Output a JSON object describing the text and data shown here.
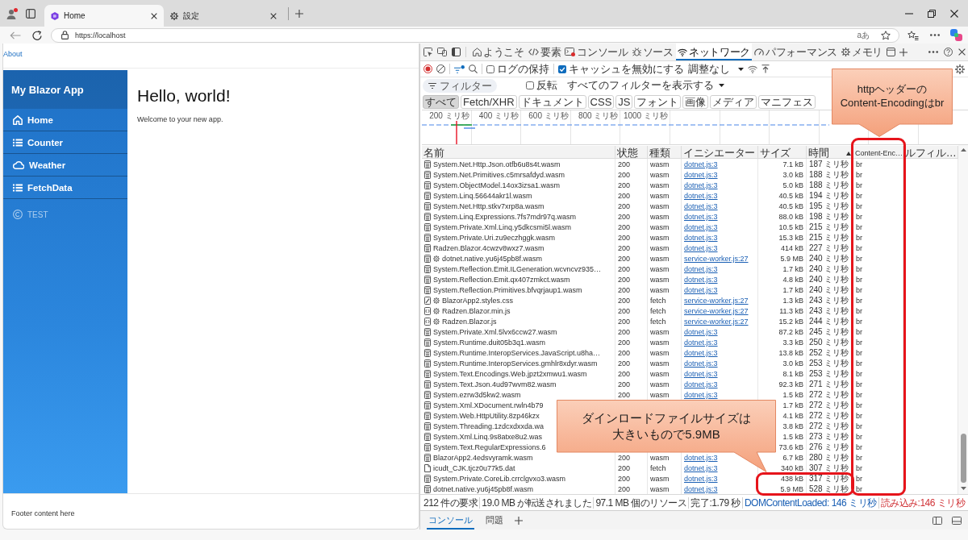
{
  "browser": {
    "tabs": [
      {
        "title": "Home",
        "selected": true
      },
      {
        "title": "設定",
        "selected": false
      }
    ],
    "address_bar": {
      "url": "https://localhost",
      "translate_button": "aあ"
    }
  },
  "page": {
    "top_row": {
      "link": "About"
    },
    "sidebar": {
      "brand": "My Blazor App",
      "items": [
        {
          "label": "Home",
          "disabled": false
        },
        {
          "label": "Counter",
          "disabled": false
        },
        {
          "label": "Weather",
          "disabled": false
        },
        {
          "label": "FetchData",
          "disabled": false
        },
        {
          "label": "TEST",
          "disabled": true
        }
      ]
    },
    "heading": "Hello, world!",
    "text": "Welcome to your new app.",
    "footer": "Footer content here"
  },
  "devtools": {
    "tabs": [
      {
        "label": "ようこそ",
        "selected": false
      },
      {
        "label": "要素",
        "selected": false
      },
      {
        "label": "コンソール",
        "selected": false
      },
      {
        "label": "ソース",
        "selected": false
      },
      {
        "label": "ネットワーク",
        "selected": true
      },
      {
        "label": "パフォーマンス",
        "selected": false
      },
      {
        "label": "メモリ",
        "selected": false
      }
    ],
    "toolbar": {
      "preserve_log": {
        "label": "ログの保持",
        "checked": false
      },
      "disable_cache": {
        "label": "キャッシュを無効にする",
        "checked": true
      },
      "throttling": "調整なし"
    },
    "filter": {
      "placeholder": "フィルター",
      "invert": {
        "label": "反転",
        "checked": false
      },
      "more_filters": "すべてのフィルターを表示する"
    },
    "type_filters": [
      {
        "label": "すべて",
        "selected": true
      },
      {
        "label": "Fetch/XHR",
        "selected": false
      },
      {
        "label": "ドキュメント",
        "selected": false
      },
      {
        "label": "CSS",
        "selected": false
      },
      {
        "label": "JS",
        "selected": false
      },
      {
        "label": "フォント",
        "selected": false
      },
      {
        "label": "画像",
        "selected": false
      },
      {
        "label": "メディア",
        "selected": false
      },
      {
        "label": "マニフェス",
        "selected": false
      }
    ],
    "timeline": {
      "ticks": [
        "200 ミリ秒",
        "400 ミリ秒",
        "600 ミリ秒",
        "800 ミリ秒",
        "1000 ミリ秒"
      ]
    },
    "table": {
      "columns": [
        {
          "label": "名前",
          "sorted": false
        },
        {
          "label": "状態",
          "sorted": false
        },
        {
          "label": "種類",
          "sorted": false
        },
        {
          "label": "イニシエーター",
          "sorted": false
        },
        {
          "label": "サイズ",
          "sorted": false
        },
        {
          "label": "時間",
          "sorted": true
        },
        {
          "label": "Content-Enc…",
          "sorted": false
        },
        {
          "label": "ルフィル…",
          "sorted": false
        }
      ],
      "rows": [
        {
          "name": "System.Net.Http.Json.otfb6u8s4t.wasm",
          "kind": "wasm",
          "service_worker": false,
          "status": "200",
          "type": "wasm",
          "initiator": "dotnet.js:3",
          "size": "7.1 kB",
          "time": "187 ミリ秒",
          "content_encoding": "br"
        },
        {
          "name": "System.Net.Primitives.c5mrsafdyd.wasm",
          "kind": "wasm",
          "service_worker": false,
          "status": "200",
          "type": "wasm",
          "initiator": "dotnet.js:3",
          "size": "3.0 kB",
          "time": "188 ミリ秒",
          "content_encoding": "br"
        },
        {
          "name": "System.ObjectModel.14ox3izsa1.wasm",
          "kind": "wasm",
          "service_worker": false,
          "status": "200",
          "type": "wasm",
          "initiator": "dotnet.js:3",
          "size": "5.0 kB",
          "time": "188 ミリ秒",
          "content_encoding": "br"
        },
        {
          "name": "System.Linq.56644akr1l.wasm",
          "kind": "wasm",
          "service_worker": false,
          "status": "200",
          "type": "wasm",
          "initiator": "dotnet.js:3",
          "size": "40.5 kB",
          "time": "194 ミリ秒",
          "content_encoding": "br"
        },
        {
          "name": "System.Net.Http.stkv7xrp8a.wasm",
          "kind": "wasm",
          "service_worker": false,
          "status": "200",
          "type": "wasm",
          "initiator": "dotnet.js:3",
          "size": "40.5 kB",
          "time": "195 ミリ秒",
          "content_encoding": "br"
        },
        {
          "name": "System.Linq.Expressions.7fs7mdr97q.wasm",
          "kind": "wasm",
          "service_worker": false,
          "status": "200",
          "type": "wasm",
          "initiator": "dotnet.js:3",
          "size": "88.0 kB",
          "time": "198 ミリ秒",
          "content_encoding": "br"
        },
        {
          "name": "System.Private.Xml.Linq.y5dkcsmi5l.wasm",
          "kind": "wasm",
          "service_worker": false,
          "status": "200",
          "type": "wasm",
          "initiator": "dotnet.js:3",
          "size": "10.5 kB",
          "time": "215 ミリ秒",
          "content_encoding": "br"
        },
        {
          "name": "System.Private.Uri.zu9eczhggk.wasm",
          "kind": "wasm",
          "service_worker": false,
          "status": "200",
          "type": "wasm",
          "initiator": "dotnet.js:3",
          "size": "15.3 kB",
          "time": "215 ミリ秒",
          "content_encoding": "br"
        },
        {
          "name": "Radzen.Blazor.4cwzv8wxz7.wasm",
          "kind": "wasm",
          "service_worker": false,
          "status": "200",
          "type": "wasm",
          "initiator": "dotnet.js:3",
          "size": "414 kB",
          "time": "227 ミリ秒",
          "content_encoding": "br"
        },
        {
          "name": "dotnet.native.yu6j45pb8f.wasm",
          "kind": "wasm",
          "service_worker": true,
          "status": "200",
          "type": "wasm",
          "initiator": "service-worker.js:27",
          "size": "5.9 MB",
          "time": "240 ミリ秒",
          "content_encoding": "br"
        },
        {
          "name": "System.Reflection.Emit.ILGeneration.wcvncvz935…",
          "kind": "wasm",
          "service_worker": false,
          "status": "200",
          "type": "wasm",
          "initiator": "dotnet.js:3",
          "size": "1.7 kB",
          "time": "240 ミリ秒",
          "content_encoding": "br"
        },
        {
          "name": "System.Reflection.Emit.qx407zmkct.wasm",
          "kind": "wasm",
          "service_worker": false,
          "status": "200",
          "type": "wasm",
          "initiator": "dotnet.js:3",
          "size": "4.8 kB",
          "time": "240 ミリ秒",
          "content_encoding": "br"
        },
        {
          "name": "System.Reflection.Primitives.bfvqrjaup1.wasm",
          "kind": "wasm",
          "service_worker": false,
          "status": "200",
          "type": "wasm",
          "initiator": "dotnet.js:3",
          "size": "1.7 kB",
          "time": "240 ミリ秒",
          "content_encoding": "br"
        },
        {
          "name": "BlazorApp2.styles.css",
          "kind": "css",
          "service_worker": true,
          "status": "200",
          "type": "fetch",
          "initiator": "service-worker.js:27",
          "size": "1.3 kB",
          "time": "243 ミリ秒",
          "content_encoding": "br"
        },
        {
          "name": "Radzen.Blazor.min.js",
          "kind": "js",
          "service_worker": true,
          "status": "200",
          "type": "fetch",
          "initiator": "service-worker.js:27",
          "size": "11.3 kB",
          "time": "243 ミリ秒",
          "content_encoding": "br"
        },
        {
          "name": "Radzen.Blazor.js",
          "kind": "js",
          "service_worker": true,
          "status": "200",
          "type": "fetch",
          "initiator": "service-worker.js:27",
          "size": "15.2 kB",
          "time": "244 ミリ秒",
          "content_encoding": "br"
        },
        {
          "name": "System.Private.Xml.5lvx6ccw27.wasm",
          "kind": "wasm",
          "service_worker": false,
          "status": "200",
          "type": "wasm",
          "initiator": "dotnet.js:3",
          "size": "87.2 kB",
          "time": "245 ミリ秒",
          "content_encoding": "br"
        },
        {
          "name": "System.Runtime.duit05b3q1.wasm",
          "kind": "wasm",
          "service_worker": false,
          "status": "200",
          "type": "wasm",
          "initiator": "dotnet.js:3",
          "size": "3.3 kB",
          "time": "250 ミリ秒",
          "content_encoding": "br"
        },
        {
          "name": "System.Runtime.InteropServices.JavaScript.u8ha…",
          "kind": "wasm",
          "service_worker": false,
          "status": "200",
          "type": "wasm",
          "initiator": "dotnet.js:3",
          "size": "13.8 kB",
          "time": "252 ミリ秒",
          "content_encoding": "br"
        },
        {
          "name": "System.Runtime.InteropServices.gmhlr8xdyr.wasm",
          "kind": "wasm",
          "service_worker": false,
          "status": "200",
          "type": "wasm",
          "initiator": "dotnet.js:3",
          "size": "3.0 kB",
          "time": "253 ミリ秒",
          "content_encoding": "br"
        },
        {
          "name": "System.Text.Encodings.Web.jpzt2xmwu1.wasm",
          "kind": "wasm",
          "service_worker": false,
          "status": "200",
          "type": "wasm",
          "initiator": "dotnet.js:3",
          "size": "8.1 kB",
          "time": "253 ミリ秒",
          "content_encoding": "br"
        },
        {
          "name": "System.Text.Json.4ud97wvm82.wasm",
          "kind": "wasm",
          "service_worker": false,
          "status": "200",
          "type": "wasm",
          "initiator": "dotnet.js:3",
          "size": "92.3 kB",
          "time": "271 ミリ秒",
          "content_encoding": "br"
        },
        {
          "name": "System.ezrw3d5kw2.wasm",
          "kind": "wasm",
          "service_worker": false,
          "status": "200",
          "type": "wasm",
          "initiator": "dotnet.js:3",
          "size": "1.5 kB",
          "time": "272 ミリ秒",
          "content_encoding": "br"
        },
        {
          "name": "System.Xml.XDocument.rwln4b79",
          "kind": "wasm",
          "service_worker": false,
          "size": "1.7 kB",
          "time": "272 ミリ秒",
          "content_encoding": "br"
        },
        {
          "name": "System.Web.HttpUtility.8zp46kzx",
          "kind": "wasm",
          "service_worker": false,
          "size": "4.1 kB",
          "time": "272 ミリ秒",
          "content_encoding": "br"
        },
        {
          "name": "System.Threading.1zdcxdxxda.wa",
          "kind": "wasm",
          "service_worker": false,
          "size": "3.8 kB",
          "time": "272 ミリ秒",
          "content_encoding": "br"
        },
        {
          "name": "System.Xml.Linq.9s8atxe8u2.was",
          "kind": "wasm",
          "service_worker": false,
          "size": "1.5 kB",
          "time": "273 ミリ秒",
          "content_encoding": "br"
        },
        {
          "name": "System.Text.RegularExpressions.6",
          "kind": "wasm",
          "service_worker": false,
          "size": "73.6 kB",
          "time": "276 ミリ秒",
          "content_encoding": "br"
        },
        {
          "name": "BlazorApp2.4edsvyramk.wasm",
          "kind": "wasm",
          "service_worker": false,
          "status": "200",
          "type": "wasm",
          "initiator": "dotnet.js:3",
          "size": "6.7 kB",
          "time": "280 ミリ秒",
          "content_encoding": "br"
        },
        {
          "name": "icudt_CJK.tjcz0u77k5.dat",
          "kind": "data",
          "service_worker": false,
          "status": "200",
          "type": "fetch",
          "initiator": "dotnet.js:3",
          "size": "340 kB",
          "time": "307 ミリ秒",
          "content_encoding": "br"
        },
        {
          "name": "System.Private.CoreLib.crrclgvxo3.wasm",
          "kind": "wasm",
          "service_worker": false,
          "status": "200",
          "type": "wasm",
          "initiator": "dotnet.js:3",
          "size": "438 kB",
          "time": "317 ミリ秒",
          "content_encoding": "br"
        },
        {
          "name": "dotnet.native.yu6j45pb8f.wasm",
          "kind": "wasm",
          "service_worker": false,
          "status": "200",
          "type": "wasm",
          "initiator": "dotnet.js:3",
          "size": "5.9 MB",
          "time": "528 ミリ秒",
          "content_encoding": "br"
        }
      ]
    },
    "status_bar": [
      {
        "text": "212 件の要求",
        "kind": "plain"
      },
      {
        "text": "19.0 MB が転送されました",
        "kind": "plain"
      },
      {
        "text": "97.1 MB 個のリソース",
        "kind": "plain"
      },
      {
        "text": "完了:1.79 秒",
        "kind": "plain"
      },
      {
        "text": "DOMContentLoaded: 146 ミリ秒",
        "kind": "domcontentloaded"
      },
      {
        "text": "読み込み:146 ミリ秒",
        "kind": "load"
      }
    ],
    "drawer_tabs": [
      {
        "label": "コンソール",
        "selected": true
      },
      {
        "label": "問題",
        "selected": false
      }
    ]
  },
  "annotations": [
    {
      "text": "httpヘッダーのContent-Encodingはbr"
    },
    {
      "text": "ダインロードファイルサイズは大きいもので5.9MB"
    }
  ]
}
